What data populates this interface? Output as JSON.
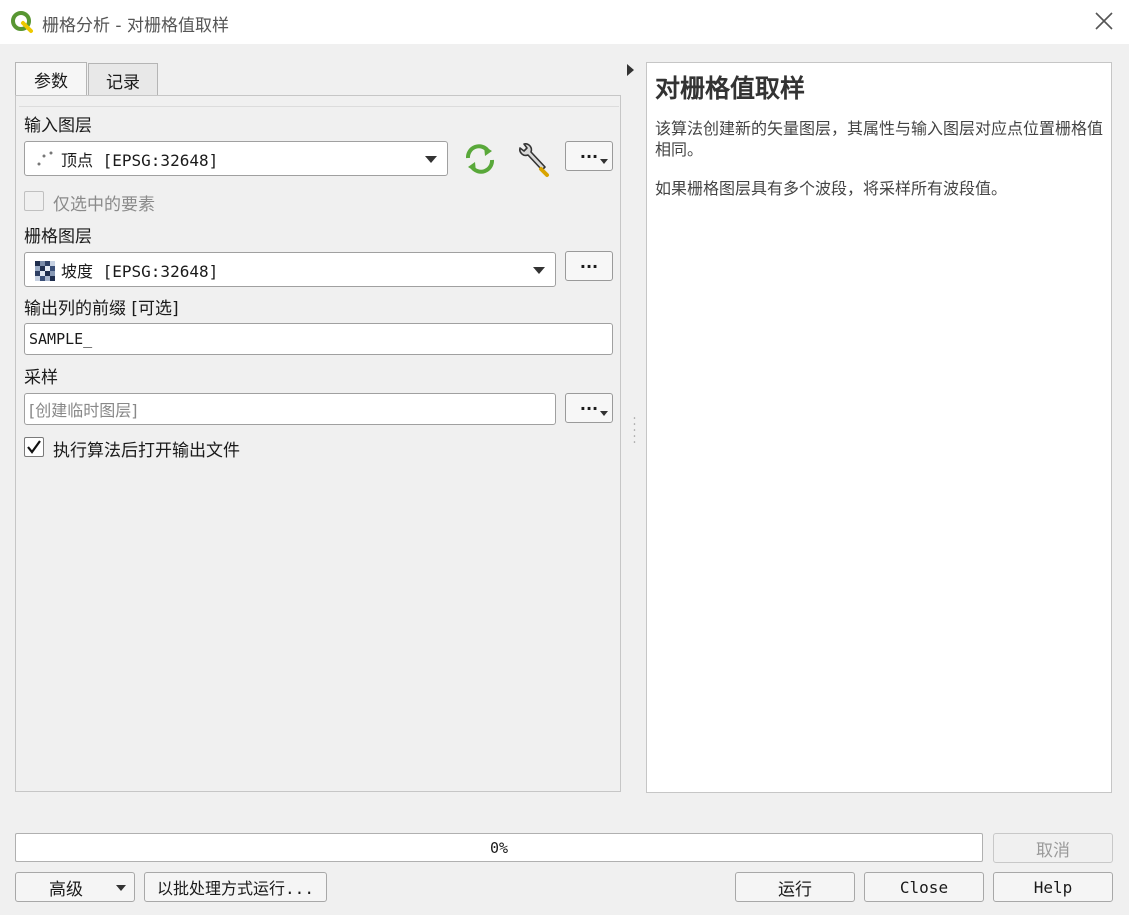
{
  "window": {
    "title": "栅格分析 - 对栅格值取样"
  },
  "tabs": [
    {
      "label": "参数"
    },
    {
      "label": "记录"
    }
  ],
  "params": {
    "input_layer_label": "输入图层",
    "input_layer_value": "顶点 [EPSG:32648]",
    "selected_only_label": "仅选中的要素",
    "raster_layer_label": "栅格图层",
    "raster_layer_value": "坡度 [EPSG:32648]",
    "prefix_label": "输出列的前缀 [可选]",
    "prefix_value": "SAMPLE_",
    "sampled_label": "采样",
    "sampled_placeholder": "[创建临时图层]",
    "open_output_label": "执行算法后打开输出文件",
    "dots": "···"
  },
  "help": {
    "title": "对栅格值取样",
    "paragraph1": "该算法创建新的矢量图层，其属性与输入图层对应点位置栅格值相同。",
    "paragraph2": "如果栅格图层具有多个波段，将采样所有波段值。"
  },
  "progress": {
    "value": 0,
    "text": "0%"
  },
  "buttons": {
    "cancel": "取消",
    "advanced": "高级",
    "batch": "以批处理方式运行...",
    "run": "运行",
    "close": "Close",
    "help": "Help"
  },
  "colors": {
    "qgis_green": "#589632",
    "qgis_yellow": "#eec900",
    "refresh_green": "#59a83a"
  }
}
